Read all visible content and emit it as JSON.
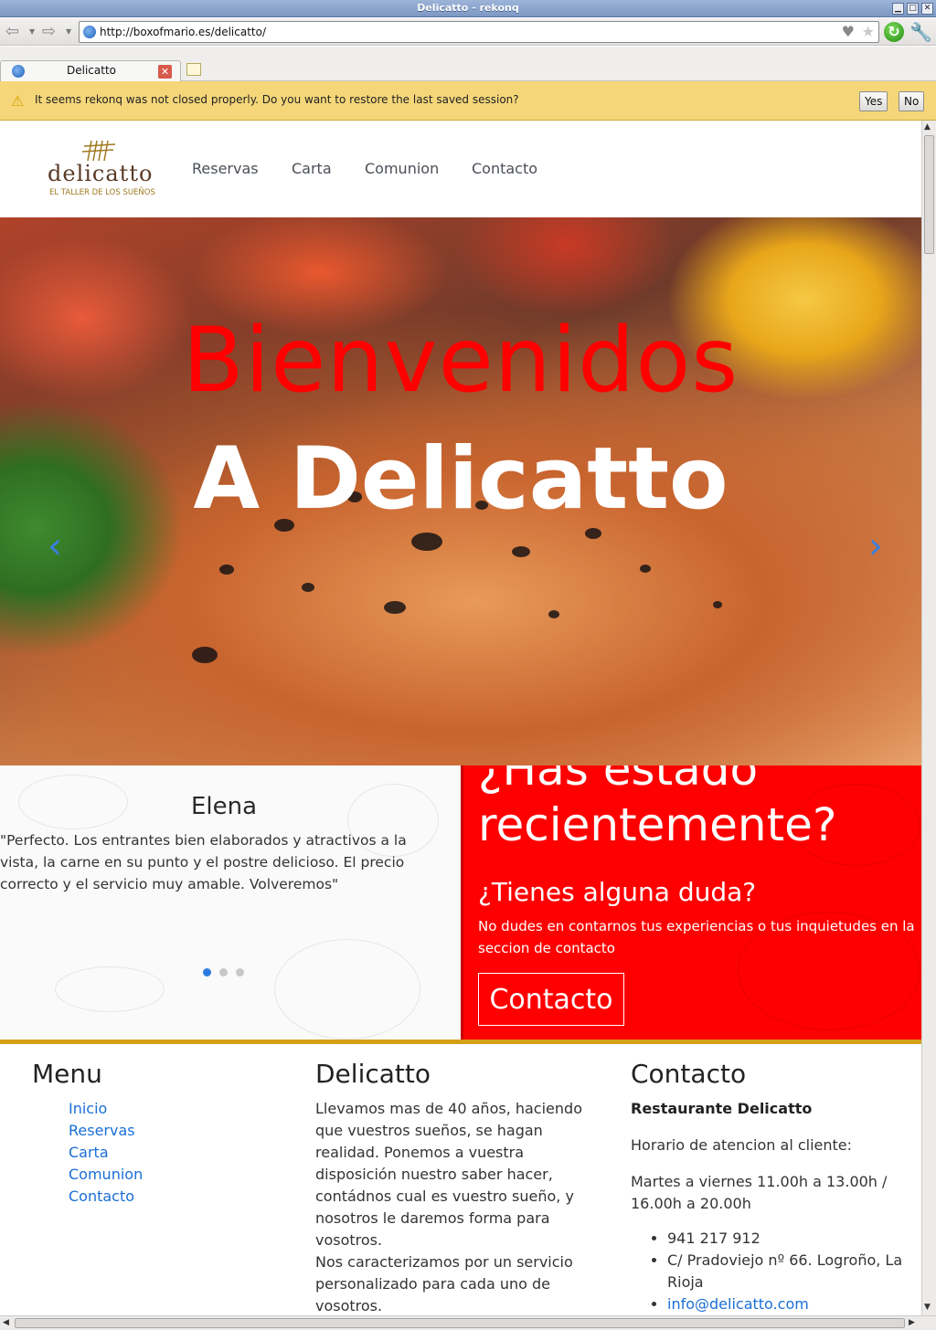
{
  "window": {
    "title": "Delicatto - rekonq"
  },
  "toolbar": {
    "url": "http://boxofmario.es/delicatto/"
  },
  "tabs": [
    {
      "label": "Delicatto"
    }
  ],
  "notification": {
    "message": "It seems rekonq was not closed properly. Do you want to restore the last saved session?",
    "yes_label": "Yes",
    "no_label": "No"
  },
  "site": {
    "logo": {
      "word": "delicatto",
      "tagline": "EL TALLER DE LOS SUEÑOS"
    },
    "nav": [
      "Reservas",
      "Carta",
      "Comunion",
      "Contacto"
    ],
    "hero": {
      "line1": "Bienvenidos",
      "line2": "A Delicatto",
      "prev_icon": "‹",
      "next_icon": "›"
    },
    "testimonial": {
      "name": "Elena",
      "quote": "\"Perfecto. Los entrantes bien elaborados y atractivos a la vista, la carne en su punto y el postre delicioso. El precio correcto y el servicio muy amable. Volveremos\""
    },
    "cta": {
      "heading": "¿Has estado recientemente?",
      "subheading": "¿Tienes alguna duda?",
      "text": "No dudes en contarnos tus experiencias o tus inquietudes en la seccion de contacto",
      "button": "Contacto"
    },
    "footer": {
      "menu": {
        "title": "Menu",
        "links": [
          "Inicio",
          "Reservas",
          "Carta",
          "Comunion",
          "Contacto"
        ]
      },
      "about": {
        "title": "Delicatto",
        "p1": "Llevamos mas de 40 años, haciendo que vuestros sueños, se hagan realidad. Ponemos a vuestra disposición nuestro saber hacer, contádnos cual es vuestro sueño, y nosotros le daremos forma para vosotros.",
        "p2": "Nos caracterizamos por un servicio personalizado para cada uno de vosotros."
      },
      "contact": {
        "title": "Contacto",
        "name": "Restaurante Delicatto",
        "hours_label": "Horario de atencion al cliente:",
        "hours": "Martes a viernes 11.00h a 13.00h / 16.00h a 20.00h",
        "phone": " 941 217 912",
        "address": "C/ Pradoviejo nº 66. Logroño, La Rioja",
        "email": "info@delicatto.com"
      }
    }
  },
  "colors": {
    "brand_red": "#ff0000",
    "accent_gold": "#d4a017",
    "link_blue": "#1a6fd6"
  }
}
